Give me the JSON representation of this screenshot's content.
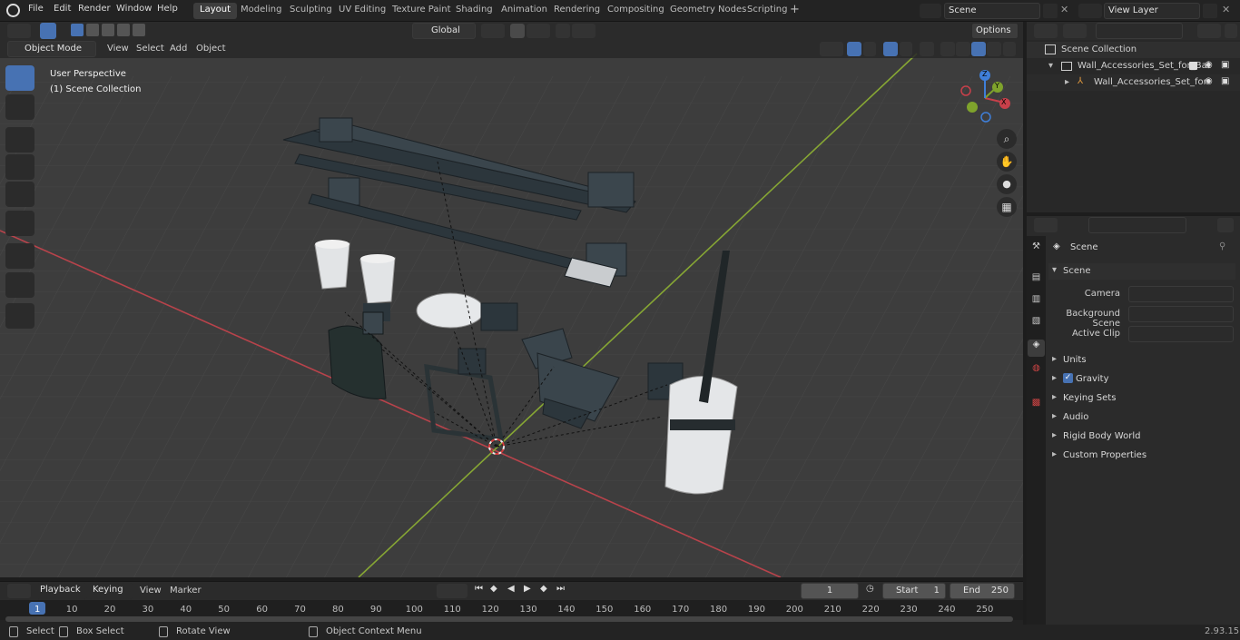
{
  "menu": {
    "file": "File",
    "edit": "Edit",
    "render": "Render",
    "window": "Window",
    "help": "Help"
  },
  "workspaces": [
    "Layout",
    "Modeling",
    "Sculpting",
    "UV Editing",
    "Texture Paint",
    "Shading",
    "Animation",
    "Rendering",
    "Compositing",
    "Geometry Nodes",
    "Scripting"
  ],
  "scene_field": "Scene",
  "view_layer_field": "View Layer",
  "viewport_header": {
    "mode": "Object Mode",
    "view": "View",
    "select": "Select",
    "add": "Add",
    "object": "Object",
    "orientation": "Global",
    "options": "Options"
  },
  "viewport_overlay": {
    "perspective": "User Perspective",
    "collection": "(1) Scene Collection"
  },
  "gizmo": {
    "x": "X",
    "y": "Y",
    "z": "Z"
  },
  "outliner": {
    "root": "Scene Collection",
    "item1": "Wall_Accessories_Set_for_Bat",
    "item2": "Wall_Accessories_Set_for"
  },
  "properties": {
    "header": "Scene",
    "panel": "Scene",
    "camera_label": "Camera",
    "background_label": "Background Scene",
    "clip_label": "Active Clip",
    "sections": [
      "Units",
      "Gravity",
      "Keying Sets",
      "Audio",
      "Rigid Body World",
      "Custom Properties"
    ]
  },
  "timeline": {
    "playback": "Playback",
    "keying": "Keying",
    "view": "View",
    "marker": "Marker",
    "current_frame": "1",
    "start_label": "Start",
    "start": "1",
    "end_label": "End",
    "end": "250",
    "ticks": [
      "1",
      "10",
      "20",
      "30",
      "40",
      "50",
      "60",
      "70",
      "80",
      "90",
      "100",
      "110",
      "120",
      "130",
      "140",
      "150",
      "160",
      "170",
      "180",
      "190",
      "200",
      "210",
      "220",
      "230",
      "240",
      "250"
    ]
  },
  "status": {
    "select": "Select",
    "box_select": "Box Select",
    "rotate": "Rotate View",
    "context": "Object Context Menu",
    "version": "2.93.15"
  },
  "colors": {
    "accent": "#4772b3",
    "x_axis": "#c8404a",
    "y_axis": "#7fa32c",
    "z_axis": "#3f7fd9"
  }
}
